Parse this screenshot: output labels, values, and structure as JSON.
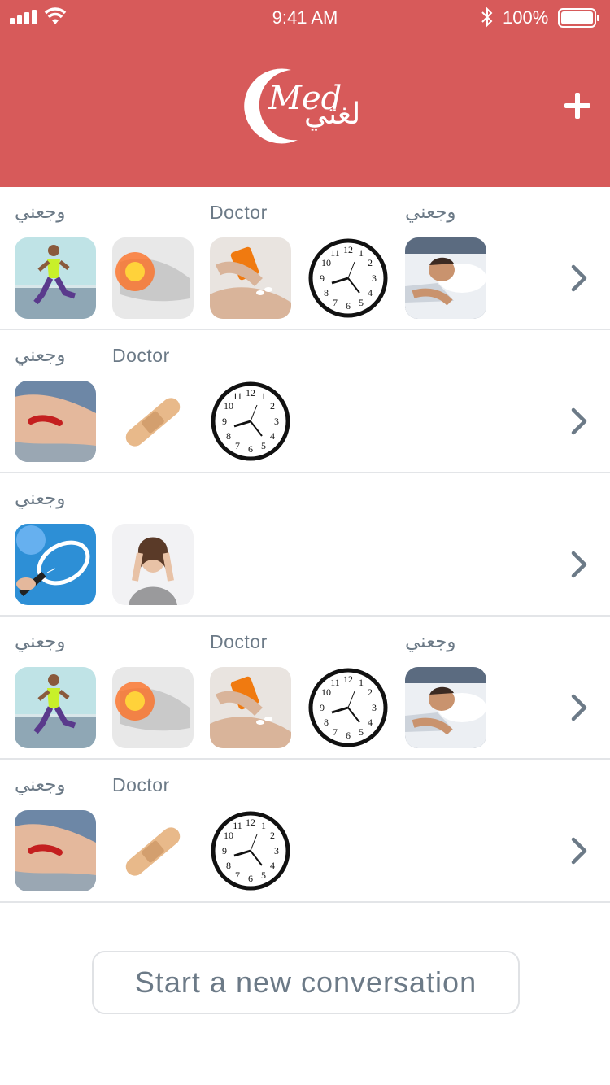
{
  "status_bar": {
    "time": "9:41 AM",
    "battery": "100%"
  },
  "header": {
    "logo_latin": "Med",
    "logo_arabic": "لغتي",
    "add_icon": "plus-icon"
  },
  "conversations": [
    {
      "labels": [
        {
          "text": "وجعني",
          "slot": 0
        },
        {
          "text": "Doctor",
          "slot": 2
        },
        {
          "text": "وجعني",
          "slot": 4
        }
      ],
      "images": [
        "runner-image",
        "injured-foot-image",
        "pills-image",
        "clock-image",
        "sleeping-man-image"
      ]
    },
    {
      "labels": [
        {
          "text": "وجعني",
          "slot": 0
        },
        {
          "text": "Doctor",
          "slot": 1
        }
      ],
      "images": [
        "scraped-arm-image",
        "bandage-image",
        "clock-image"
      ]
    },
    {
      "labels": [
        {
          "text": "وجعني",
          "slot": 0
        }
      ],
      "images": [
        "tennis-racket-image",
        "headache-woman-image"
      ]
    },
    {
      "labels": [
        {
          "text": "وجعني",
          "slot": 0
        },
        {
          "text": "Doctor",
          "slot": 2
        },
        {
          "text": "وجعني",
          "slot": 4
        }
      ],
      "images": [
        "runner-image",
        "injured-foot-image",
        "pills-image",
        "clock-image",
        "sleeping-man-image"
      ]
    },
    {
      "labels": [
        {
          "text": "وجعني",
          "slot": 0
        },
        {
          "text": "Doctor",
          "slot": 1
        }
      ],
      "images": [
        "scraped-arm-image",
        "bandage-image",
        "clock-image"
      ]
    }
  ],
  "new_conversation_label": "Start a new conversation",
  "colors": {
    "header": "#d75a5a",
    "label": "#6c7a87",
    "divider": "#e3e5e8"
  }
}
